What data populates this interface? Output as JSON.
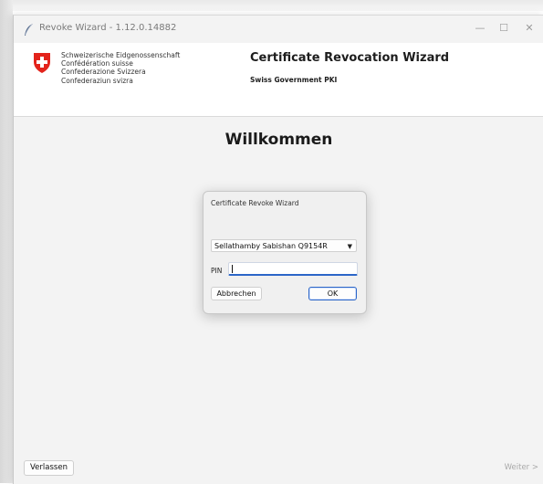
{
  "window": {
    "title": "Revoke Wizard - 1.12.0.14882",
    "minimize_glyph": "—",
    "maximize_glyph": "☐",
    "close_glyph": "✕"
  },
  "header": {
    "confederation_lines": [
      "Schweizerische Eidgenossenschaft",
      "Confédération suisse",
      "Confederazione Svizzera",
      "Confederaziun svizra"
    ],
    "app_title": "Certificate Revocation Wizard",
    "app_subtitle": "Swiss Government PKI",
    "crest_color": "#e3231b"
  },
  "main": {
    "welcome": "Willkommen"
  },
  "dialog": {
    "title": "Certificate Revoke Wizard",
    "certificate_selected": "Sellathamby Sabishan Q9154R",
    "pin_label": "PIN",
    "pin_value": "",
    "cancel_label": "Abbrechen",
    "ok_label": "OK"
  },
  "footer": {
    "leave_label": "Verlassen",
    "next_label": "Weiter >"
  },
  "colors": {
    "accent": "#2c66c8",
    "disabled_text": "#a9a9a9"
  }
}
